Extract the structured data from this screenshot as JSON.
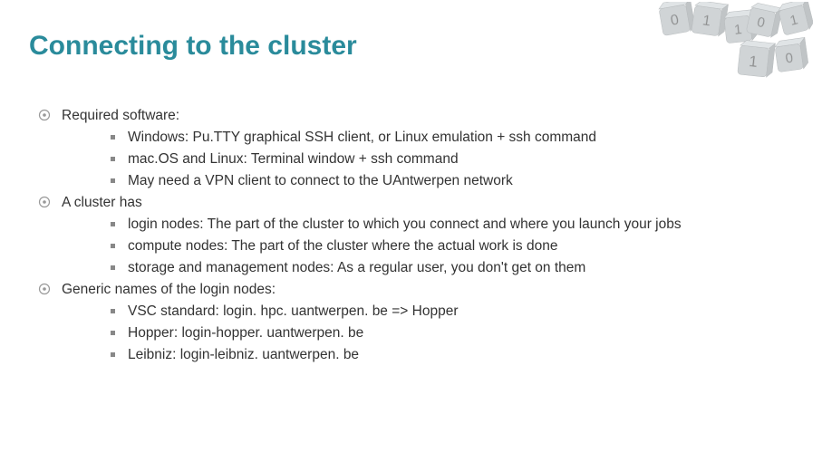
{
  "title": "Connecting to the cluster",
  "items": [
    {
      "text": "Required software:",
      "subs": [
        "Windows: Pu.TTY graphical SSH client, or Linux emulation + ssh command",
        "mac.OS and Linux: Terminal window + ssh command",
        "May need a VPN client to connect to the UAntwerpen network"
      ]
    },
    {
      "text": "A cluster has",
      "subs": [
        "login nodes: The part of the cluster to which you connect and where you launch your jobs",
        "compute nodes: The part of the cluster where the actual work is done",
        "storage and management nodes: As a regular user, you don't get on them"
      ]
    },
    {
      "text": "Generic names of the login nodes:",
      "subs": [
        "VSC standard: login. hpc. uantwerpen. be => Hopper",
        "Hopper: login-hopper. uantwerpen. be",
        "Leibniz: login-leibniz. uantwerpen. be"
      ]
    }
  ]
}
